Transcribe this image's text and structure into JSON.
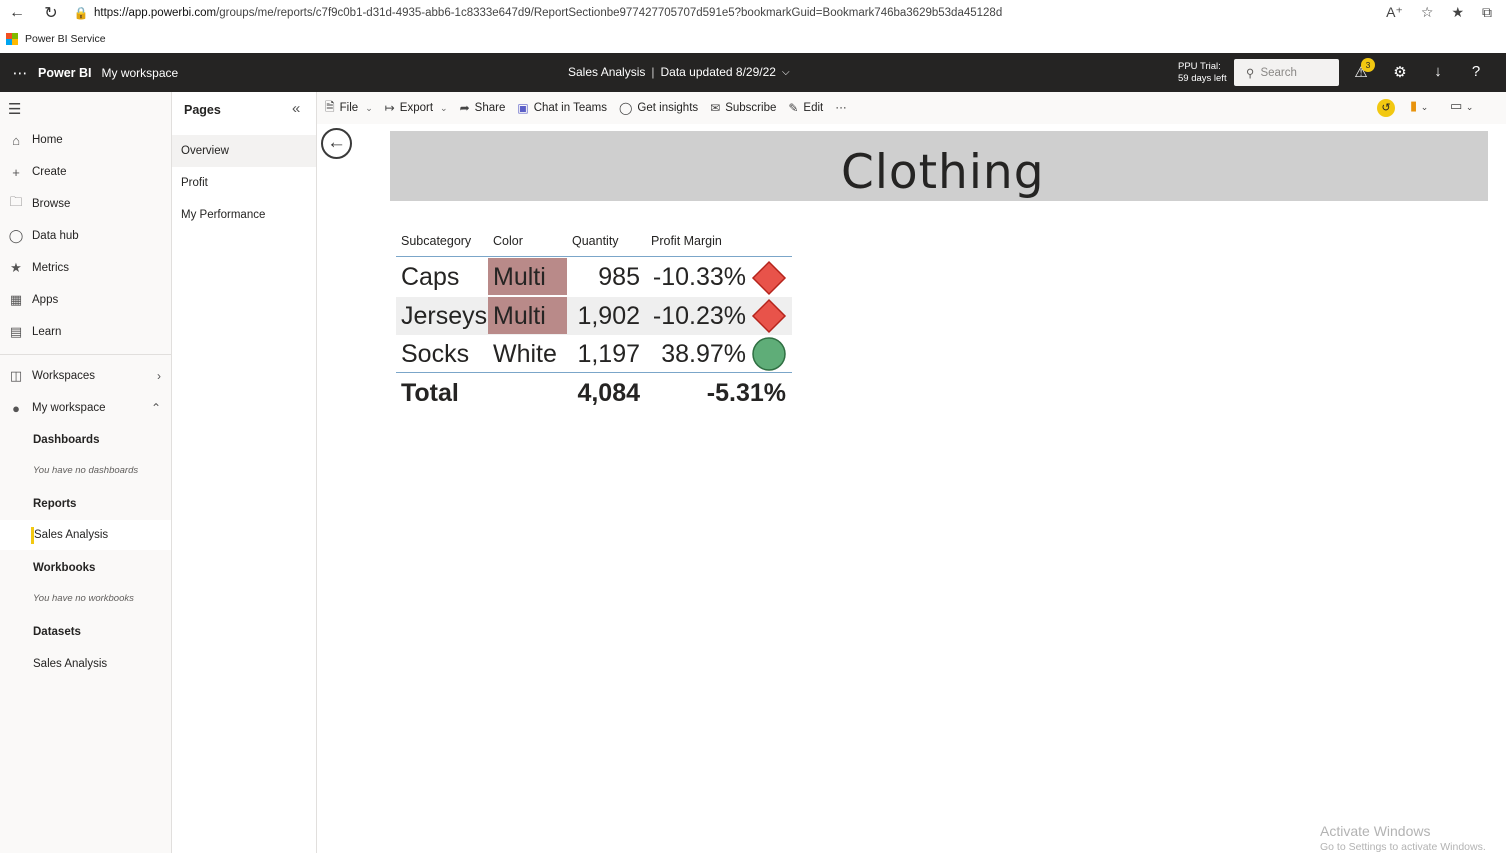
{
  "browser": {
    "url_host": "https://app.powerbi.com",
    "url_path": "/groups/me/reports/c7f9c0b1-d31d-4935-abb6-1c8333e647d9/ReportSectionbe977427705707d591e5?bookmarkGuid=Bookmark746ba3629b53da45128d",
    "favorite": "Power BI Service"
  },
  "header": {
    "brand": "Power BI",
    "workspace": "My workspace",
    "report_title": "Sales Analysis",
    "separator": "|",
    "data_updated": "Data updated 8/29/22",
    "ppu_line1": "PPU Trial:",
    "ppu_line2": "59 days left",
    "search_placeholder": "Search",
    "notification_count": "3"
  },
  "left_nav": {
    "items": [
      {
        "label": "Home",
        "icon": "home-icon"
      },
      {
        "label": "Create",
        "icon": "plus-icon"
      },
      {
        "label": "Browse",
        "icon": "folder-icon"
      },
      {
        "label": "Data hub",
        "icon": "database-icon"
      },
      {
        "label": "Metrics",
        "icon": "trophy-icon"
      },
      {
        "label": "Apps",
        "icon": "apps-icon"
      },
      {
        "label": "Learn",
        "icon": "book-icon"
      },
      {
        "label": "Workspaces",
        "icon": "workspaces-icon"
      },
      {
        "label": "My workspace",
        "icon": "user-icon"
      }
    ],
    "sections": {
      "dashboards": "Dashboards",
      "dashboards_empty": "You have no dashboards",
      "reports": "Reports",
      "reports_item": "Sales Analysis",
      "workbooks": "Workbooks",
      "workbooks_empty": "You have no workbooks",
      "datasets": "Datasets",
      "datasets_item": "Sales Analysis"
    }
  },
  "pages": {
    "title": "Pages",
    "items": [
      "Overview",
      "Profit",
      "My Performance"
    ],
    "selected": "Overview"
  },
  "action_bar": {
    "file": "File",
    "export": "Export",
    "share": "Share",
    "chat": "Chat in Teams",
    "insights": "Get insights",
    "subscribe": "Subscribe",
    "edit": "Edit",
    "more": "···"
  },
  "report": {
    "banner_title": "Clothing",
    "columns": [
      "Subcategory",
      "Color",
      "Quantity",
      "Profit Margin"
    ],
    "rows": [
      {
        "subcategory": "Caps",
        "color": "Multi",
        "quantity": "985",
        "profit_margin": "-10.33%",
        "kpi": "red-diamond"
      },
      {
        "subcategory": "Jerseys",
        "color": "Multi",
        "quantity": "1,902",
        "profit_margin": "-10.23%",
        "kpi": "red-diamond"
      },
      {
        "subcategory": "Socks",
        "color": "White",
        "quantity": "1,197",
        "profit_margin": "38.97%",
        "kpi": "green-circle"
      }
    ],
    "total": {
      "label": "Total",
      "quantity": "4,084",
      "profit_margin": "-5.31%"
    },
    "colors": {
      "highlight": "#b98a89",
      "red_kpi": "#e8534a",
      "green_kpi": "#5fad78",
      "banded_row": "#efefef",
      "accent": "#f2c811"
    }
  },
  "watermark": {
    "line1": "Activate Windows",
    "line2": "Go to Settings to activate Windows."
  }
}
